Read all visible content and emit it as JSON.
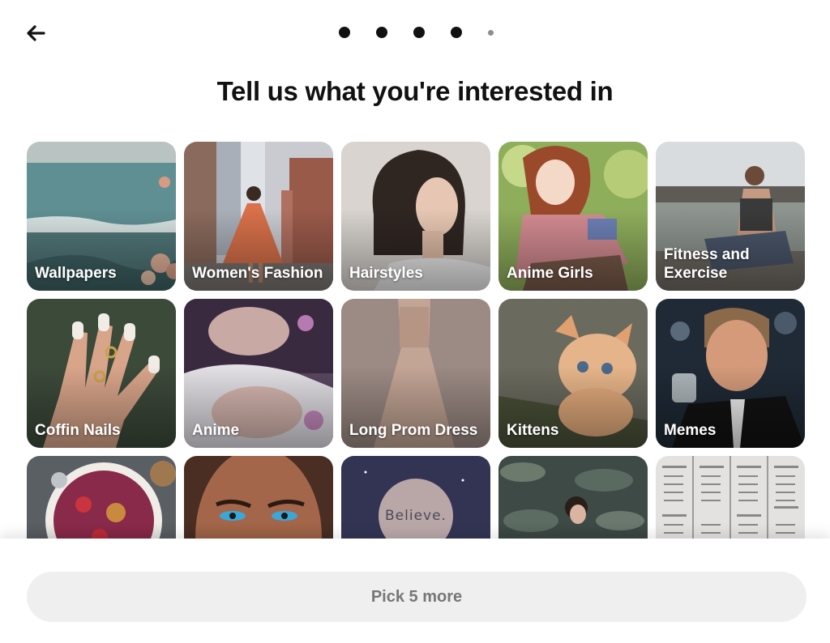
{
  "header": {
    "back_icon": "arrow-left-icon",
    "progress": {
      "total_steps": 5,
      "completed_steps": 4,
      "current_step": 5
    }
  },
  "title": "Tell us what you're interested in",
  "topics": [
    {
      "label": "Wallpapers",
      "image": "sea-shore-flowers"
    },
    {
      "label": "Women's Fashion",
      "image": "woman-orange-dress-street"
    },
    {
      "label": "Hairstyles",
      "image": "bob-haircut-portrait"
    },
    {
      "label": "Anime Girls",
      "image": "anime-girl-reading"
    },
    {
      "label": "Fitness and Exercise",
      "image": "woman-stretching-waterfront"
    },
    {
      "label": "Coffin Nails",
      "image": "manicured-hand-rings"
    },
    {
      "label": "Anime",
      "image": "anime-twins-flowers"
    },
    {
      "label": "Long Prom Dress",
      "image": "beige-gown"
    },
    {
      "label": "Kittens",
      "image": "orange-kitten"
    },
    {
      "label": "Memes",
      "image": "man-raising-glass"
    },
    {
      "label": "",
      "image": "acai-bowl-berries"
    },
    {
      "label": "",
      "image": "woman-blue-eyeliner"
    },
    {
      "label": "",
      "image": "galaxy-moon",
      "image_text": "Believe."
    },
    {
      "label": "",
      "image": "woman-in-water-lilies"
    },
    {
      "label": "",
      "image": "word-list-sheet"
    }
  ],
  "footer": {
    "button_label": "Pick 5 more"
  },
  "colors": {
    "text": "#111111",
    "button_bg": "#efefef",
    "button_text": "#767676",
    "dot_active": "#111111",
    "dot_inactive": "#8e8e8e"
  }
}
